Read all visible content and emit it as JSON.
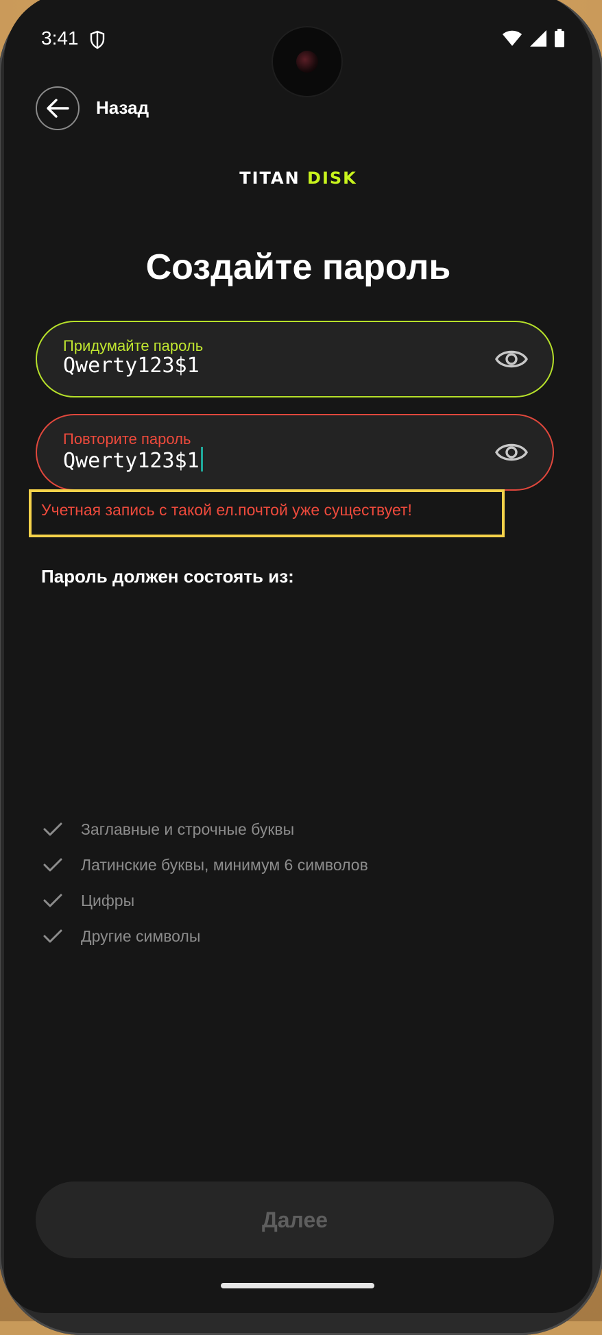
{
  "status_bar": {
    "time": "3:41",
    "icons": [
      "shield-icon",
      "wifi-icon",
      "signal-icon",
      "battery-icon"
    ]
  },
  "header": {
    "back_label": "Назад"
  },
  "logo": {
    "part1": "TITAN",
    "part2": "DISK",
    "accent_color": "#c8f31d"
  },
  "title": "Создайте пароль",
  "password_field": {
    "label": "Придумайте пароль",
    "value": "Qwerty123$1"
  },
  "repeat_field": {
    "label": "Повторите пароль",
    "value": "Qwerty123$1"
  },
  "error_message": "Учетная запись с такой ел.почтой уже существует!",
  "requirements": {
    "heading": "Пароль должен состоять из:",
    "items": [
      {
        "label": "Заглавные и строчные буквы",
        "icon": "check-icon"
      },
      {
        "label": "Латинские буквы, минимум 6 символов",
        "icon": "check-icon"
      },
      {
        "label": "Цифры",
        "icon": "check-icon"
      },
      {
        "label": "Другие символы",
        "icon": "check-icon"
      }
    ]
  },
  "next_button": {
    "label": "Далее",
    "state": "disabled"
  },
  "colors": {
    "background": "#161616",
    "accent": "#c8f31d",
    "error": "#ee4a3c",
    "highlight": "#f5d24a"
  }
}
